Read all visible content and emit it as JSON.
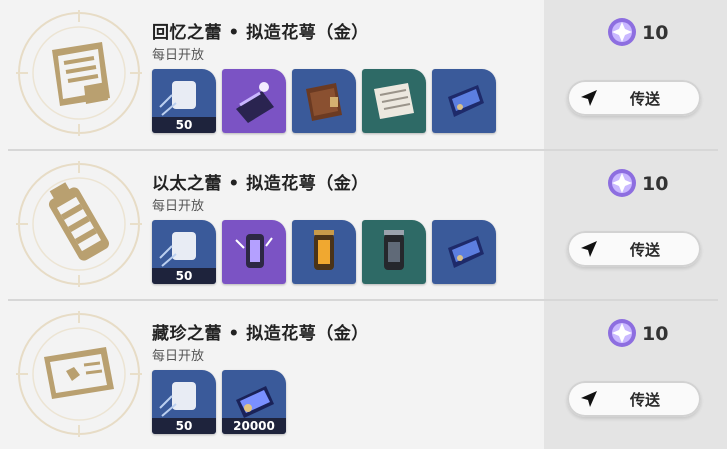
{
  "rows": [
    {
      "title": "回忆之蕾 • 拟造花萼（金）",
      "subtitle": "每日开放",
      "emblem_icon": "book-emblem-icon",
      "items": [
        {
          "icon": "exp-material-icon",
          "qty": "50",
          "bg": "#3a5a9a"
        },
        {
          "icon": "purple-book-icon",
          "qty": "",
          "bg": "#7b53c4"
        },
        {
          "icon": "brown-book-icon",
          "qty": "",
          "bg": "#3a5a9a"
        },
        {
          "icon": "paper-notes-icon",
          "qty": "",
          "bg": "#2e6a66"
        },
        {
          "icon": "blue-card-icon",
          "qty": "",
          "bg": "#3a5a9a"
        }
      ],
      "cost": "10",
      "teleport_label": "传送"
    },
    {
      "title": "以太之蕾 • 拟造花萼（金）",
      "subtitle": "每日开放",
      "emblem_icon": "canister-emblem-icon",
      "items": [
        {
          "icon": "exp-material-icon",
          "qty": "50",
          "bg": "#3a5a9a"
        },
        {
          "icon": "purple-lantern-icon",
          "qty": "",
          "bg": "#7b53c4"
        },
        {
          "icon": "gold-lantern-icon",
          "qty": "",
          "bg": "#3a5a9a"
        },
        {
          "icon": "teal-lantern-icon",
          "qty": "",
          "bg": "#2e6a66"
        },
        {
          "icon": "blue-card-icon",
          "qty": "",
          "bg": "#3a5a9a"
        }
      ],
      "cost": "10",
      "teleport_label": "传送"
    },
    {
      "title": "藏珍之蕾 • 拟造花萼（金）",
      "subtitle": "每日开放",
      "emblem_icon": "ticket-emblem-icon",
      "items": [
        {
          "icon": "exp-material-icon",
          "qty": "50",
          "bg": "#3a5a9a"
        },
        {
          "icon": "credit-card-icon",
          "qty": "20000",
          "bg": "#3a5a9a"
        }
      ],
      "cost": "10",
      "teleport_label": "传送"
    }
  ],
  "colors": {
    "gold": "#b9a070",
    "purple_item": "#7b53c4",
    "blue_item": "#3a5a9a",
    "teal_item": "#2e6a66"
  }
}
